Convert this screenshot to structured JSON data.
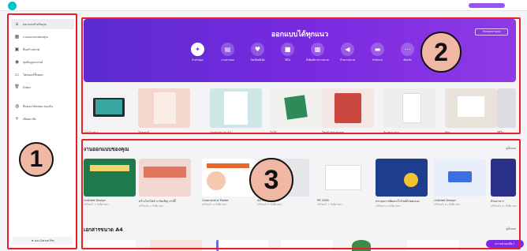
{
  "sidebar": {
    "items": [
      {
        "label": "ออกแบบสำหรับคุณ",
        "icon": "home-icon",
        "glyph": "⌂"
      },
      {
        "label": "งานออกแบบของคุณ",
        "icon": "grid-icon",
        "glyph": "▦"
      },
      {
        "label": "ทีมสร้างสรรค์",
        "icon": "image-icon",
        "glyph": "▣"
      },
      {
        "label": "ชุดข้อมูลแบรนด์",
        "icon": "palette-icon",
        "glyph": "◉"
      },
      {
        "label": "โฟลเดอร์ทั้งหมด",
        "icon": "folder-icon",
        "glyph": "▭"
      },
      {
        "label": "ถังขยะ",
        "icon": "trash-icon",
        "glyph": "🗑"
      },
      {
        "label": "ทีมของ Mambo ของฉัน",
        "icon": "team-icon",
        "glyph": "◍"
      },
      {
        "label": "เพิ่มสมาชิก",
        "icon": "plus-icon",
        "glyph": "+"
      }
    ],
    "pro_label": "★ ลอง Canva Pro"
  },
  "banner": {
    "title": "ออกแบบได้ทุกแนว",
    "button_label": "กำหนดขนาดเอง",
    "categories": [
      {
        "label": "สำหรับคุณ",
        "icon": "sparkle-icon",
        "glyph": "✦"
      },
      {
        "label": "งานนำเสนอ",
        "icon": "presentation-icon",
        "glyph": "▤"
      },
      {
        "label": "โซเชียลมีเดีย",
        "icon": "heart-chat-icon",
        "glyph": "♥"
      },
      {
        "label": "วิดีโอ",
        "icon": "video-icon",
        "glyph": "■"
      },
      {
        "label": "สิ่งพิมพ์ทางการตลาด",
        "icon": "print-icon",
        "glyph": "▩"
      },
      {
        "label": "ป้ายการตลาด",
        "icon": "megaphone-icon",
        "glyph": "◀"
      },
      {
        "label": "สำนักงาน",
        "icon": "briefcase-icon",
        "glyph": "▬"
      },
      {
        "label": "เพิ่มเติม",
        "icon": "more-icon",
        "glyph": "⋯"
      }
    ]
  },
  "suggestions": [
    {
      "label": "งานนำเสนอ",
      "bg": "#f3f3f5"
    },
    {
      "label": "โปสเตอร์",
      "bg": "#f4d6cf"
    },
    {
      "label": "เอกสารขนาด A4",
      "bg": "#cfe6e6"
    },
    {
      "label": "โลโก้",
      "bg": "#f0f0ef"
    },
    {
      "label": "โพสต์ Instagram",
      "bg": "#f3e6e4"
    },
    {
      "label": "อินสตาแกรม",
      "bg": "#eeeeee"
    },
    {
      "label": "บัตร",
      "bg": "#e9e3dc"
    },
    {
      "label": "วิดีโอ",
      "bg": "#dddbe4"
    }
  ],
  "designs_title": "งานออกแบบของคุณ",
  "see_all": "ดูทั้งหมด",
  "designs": [
    {
      "name": "Untitled Design",
      "meta": "แก้ไขแล้ว 1 วันที่ผ่านมา",
      "bg": "#1f7a4b"
    },
    {
      "name": "สร้างโปรไฟล์ การ์ดเชิญ ปาร์ตี้",
      "meta": "แก้ไขแล้ว 2 วันที่ผ่านมา",
      "bg": "#f1d7d0"
    },
    {
      "name": "Coronavirus Poster",
      "meta": "แก้ไขแล้ว 3 วันที่ผ่านมา",
      "bg": "#ffffff"
    },
    {
      "name": "A4 Presentation",
      "meta": "แก้ไขแล้ว 5 วันที่ผ่านมา",
      "bg": "#e6e6ea"
    },
    {
      "name": "PR 2565",
      "meta": "แก้ไขแล้ว 7 วันที่ผ่านมา",
      "bg": "#f4f4f6"
    },
    {
      "name": "ประชุมการพัฒนาเว็บไซต์ด้วยตนเอง",
      "meta": "แก้ไขแล้ว 9 วันที่ผ่านมา",
      "bg": "#1d3d8f"
    },
    {
      "name": "Untitled Design",
      "meta": "แก้ไขแล้ว 11 วันที่ผ่านมา",
      "bg": "#e9eefc"
    },
    {
      "name": "ป้ายอาหาร",
      "meta": "แก้ไขแล้ว 12 วันที่ผ่านมา",
      "bg": "#2a2f8a"
    }
  ],
  "a4_title": "เอกสารขนาด A4",
  "help_label": "ความช่วยเหลือ ?",
  "annotations": [
    {
      "number": "1"
    },
    {
      "number": "2"
    },
    {
      "number": "3"
    }
  ]
}
